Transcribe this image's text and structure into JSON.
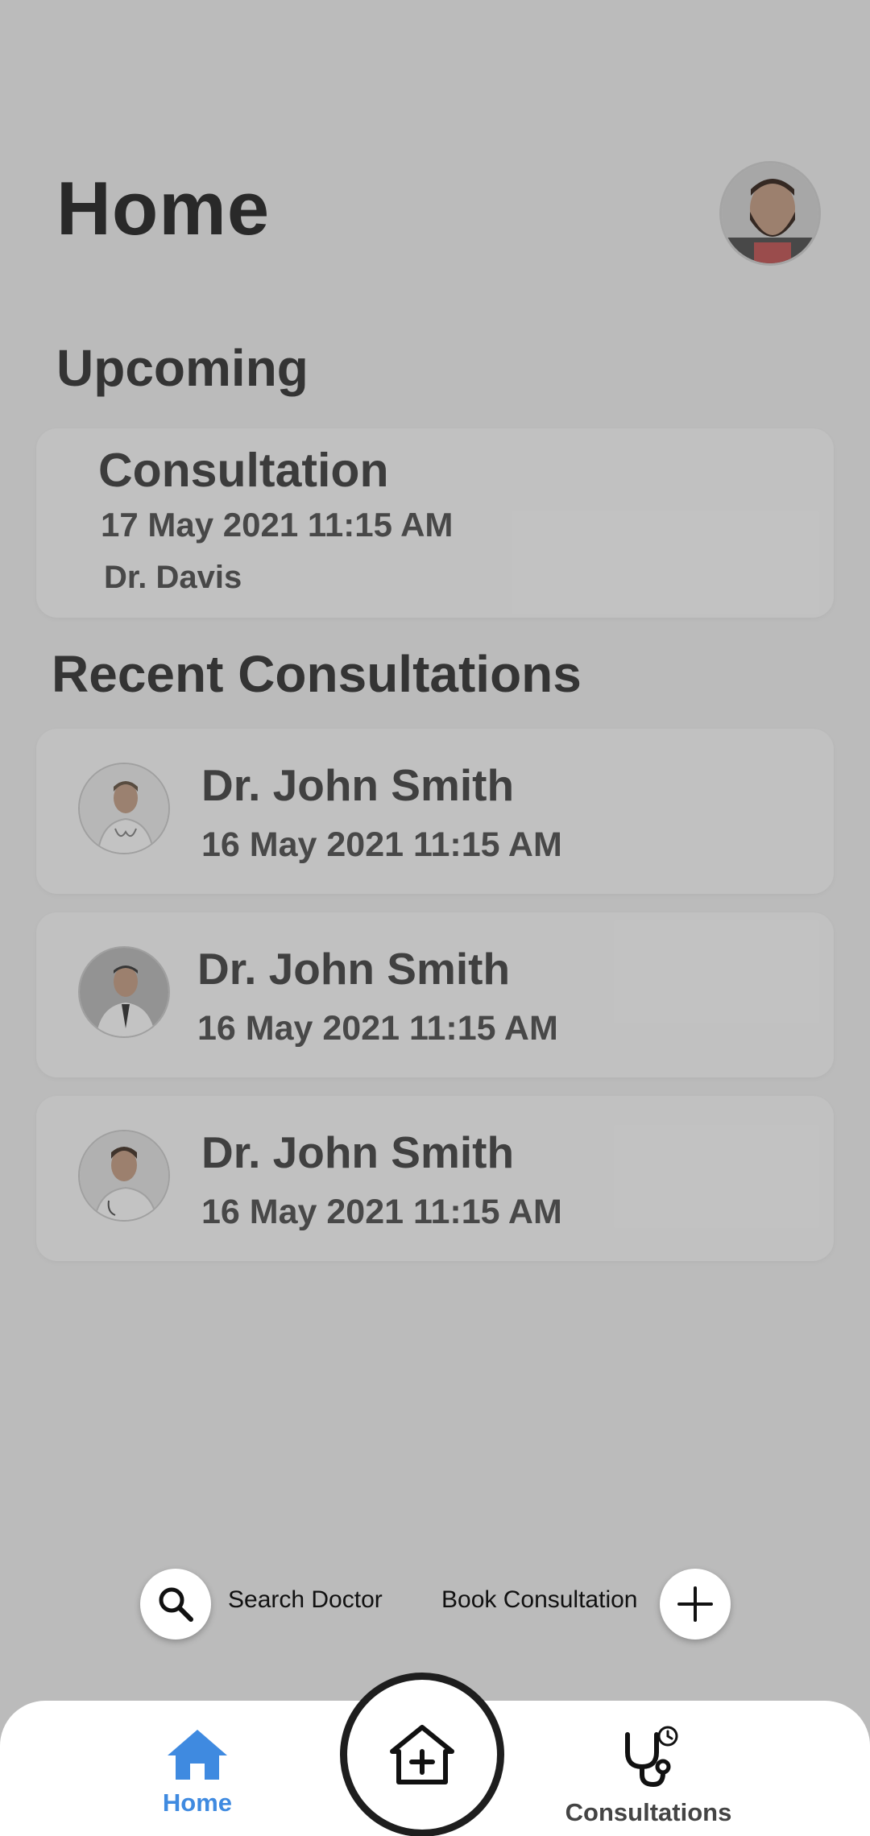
{
  "header": {
    "title": "Home"
  },
  "upcoming": {
    "section_title": "Upcoming",
    "card": {
      "title": "Consultation",
      "datetime": "17 May 2021  11:15 AM",
      "doctor": "Dr. Davis"
    }
  },
  "recent": {
    "section_title": "Recent Consultations",
    "items": [
      {
        "doctor": "Dr. John Smith",
        "datetime": "16 May 2021  11:15 AM"
      },
      {
        "doctor": "Dr. John Smith",
        "datetime": "16 May 2021  11:15 AM"
      },
      {
        "doctor": "Dr. John Smith",
        "datetime": "16 May 2021  11:15 AM"
      }
    ]
  },
  "fab_menu": {
    "search_label": "Search Doctor",
    "book_label": "Book Consultation"
  },
  "bottom_nav": {
    "home_label": "Home",
    "consultations_label": "Consultations",
    "active_color": "#3f8ae0"
  }
}
